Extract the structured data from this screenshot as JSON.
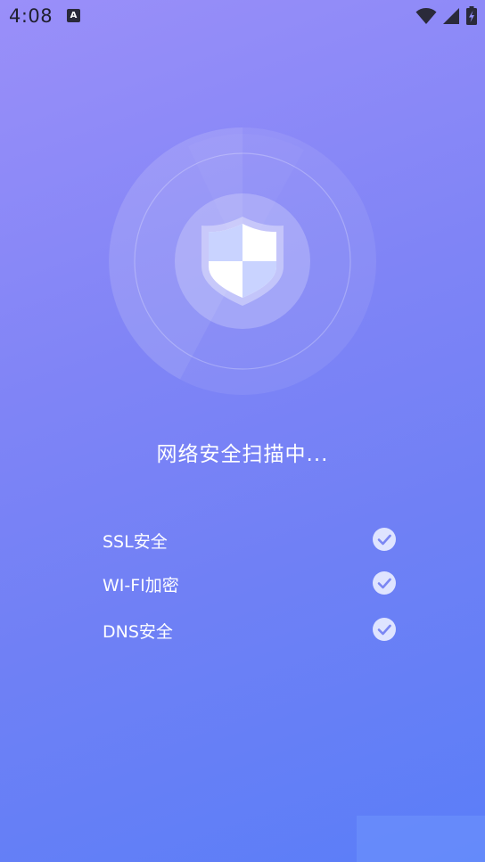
{
  "status_bar": {
    "time": "4:08",
    "notification_icon_letter": "A",
    "icons": [
      "wifi-icon",
      "cellular-signal-icon",
      "battery-charging-icon"
    ]
  },
  "scanner": {
    "icon": "shield-icon",
    "progress_arc": "partial-sweep"
  },
  "scan_title": "网络安全扫描中...",
  "checks": [
    {
      "label": "SSL安全",
      "status": "checked",
      "icon": "check-circle-icon"
    },
    {
      "label": "WI-FI加密",
      "status": "checked",
      "icon": "check-circle-icon"
    },
    {
      "label": "DNS安全",
      "status": "checked",
      "icon": "check-circle-icon"
    }
  ],
  "colors": {
    "background_top": "#9a8ff9",
    "background_bottom": "#5a7ef8",
    "shield_fill": "#ffffff",
    "shield_accent": "#c9d3ff",
    "text": "#ffffff",
    "check_circle": "#dfe4ff",
    "check_mark": "#7b87f3"
  }
}
